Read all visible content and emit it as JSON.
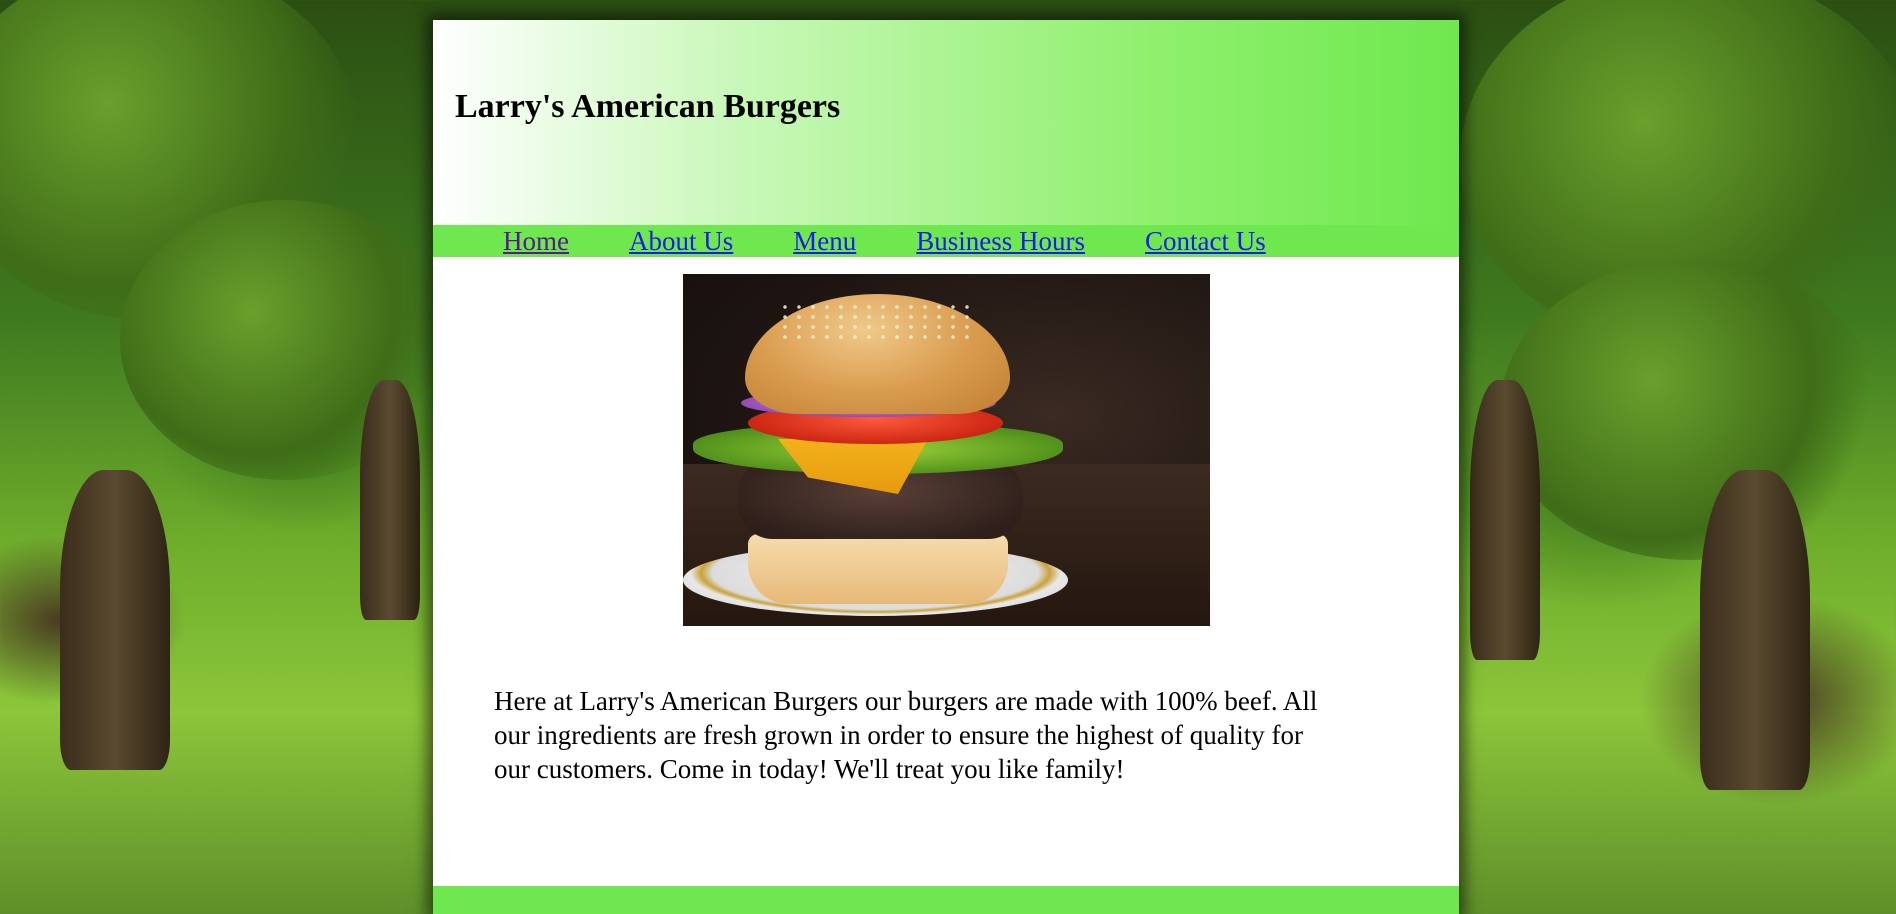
{
  "header": {
    "site_title": "Larry's American Burgers"
  },
  "nav": {
    "items": [
      {
        "label": "Home",
        "visited": true
      },
      {
        "label": "About Us",
        "visited": false
      },
      {
        "label": "Menu",
        "visited": false
      },
      {
        "label": "Business Hours",
        "visited": false
      },
      {
        "label": "Contact Us",
        "visited": false
      }
    ]
  },
  "main": {
    "hero_image": "burger-photo",
    "intro_text": "Here at Larry's American Burgers our burgers are made with 100% beef. All our ingredients are fresh grown in order to ensure the highest of quality for our customers. Come in today! We'll treat you like family!"
  },
  "colors": {
    "accent_green": "#6ee84e",
    "link": "#1a1aee",
    "link_visited": "#551a8b"
  }
}
